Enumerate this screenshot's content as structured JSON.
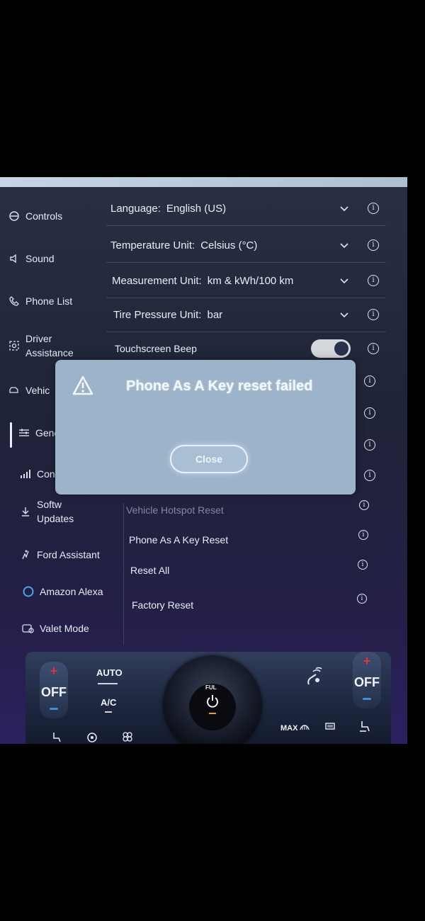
{
  "sidebar": {
    "items": [
      {
        "icon": "controls-icon",
        "label": "Controls"
      },
      {
        "icon": "speaker-icon",
        "label": "Sound"
      },
      {
        "icon": "phone-icon",
        "label": "Phone List"
      },
      {
        "icon": "driver-assist-icon",
        "label": "Driver\nAssistance"
      },
      {
        "icon": "vehicle-icon",
        "label": "Vehic"
      },
      {
        "icon": "sliders-icon",
        "label": "Gene"
      },
      {
        "icon": "signal-icon",
        "label": "Conn"
      },
      {
        "icon": "download-icon",
        "label": "Softw\nUpdates"
      },
      {
        "icon": "ford-assistant-icon",
        "label": "Ford Assistant"
      },
      {
        "icon": "alexa-icon",
        "label": "Amazon Alexa"
      },
      {
        "icon": "valet-icon",
        "label": "Valet Mode"
      }
    ]
  },
  "settings": {
    "language": {
      "label": "Language:",
      "value": "English (US)"
    },
    "temperature": {
      "label": "Temperature Unit:",
      "value": "Celsius (°C)"
    },
    "measurement": {
      "label": "Measurement Unit:",
      "value": "km & kWh/100 km"
    },
    "tire_pressure": {
      "label": "Tire Pressure Unit:",
      "value": "bar"
    },
    "touchscreen_beep": {
      "label": "Touchscreen Beep",
      "enabled": true
    }
  },
  "resets": {
    "vehicle_hotspot": "Vehicle Hotspot Reset",
    "phone_as_key": "Phone As A Key Reset",
    "reset_all": "Reset All",
    "factory_reset": "Factory Reset"
  },
  "dialog": {
    "message": "Phone As A Key reset failed",
    "close_label": "Close"
  },
  "climate": {
    "left_temp": "OFF",
    "right_temp": "OFF",
    "auto_label": "AUTO",
    "ac_label": "A/C",
    "max_label": "MAX",
    "fan_label": "FUL"
  },
  "colors": {
    "accent_red": "#e2343f",
    "accent_blue": "#3c8ee0",
    "dialog_bg": "#9db3c9"
  }
}
